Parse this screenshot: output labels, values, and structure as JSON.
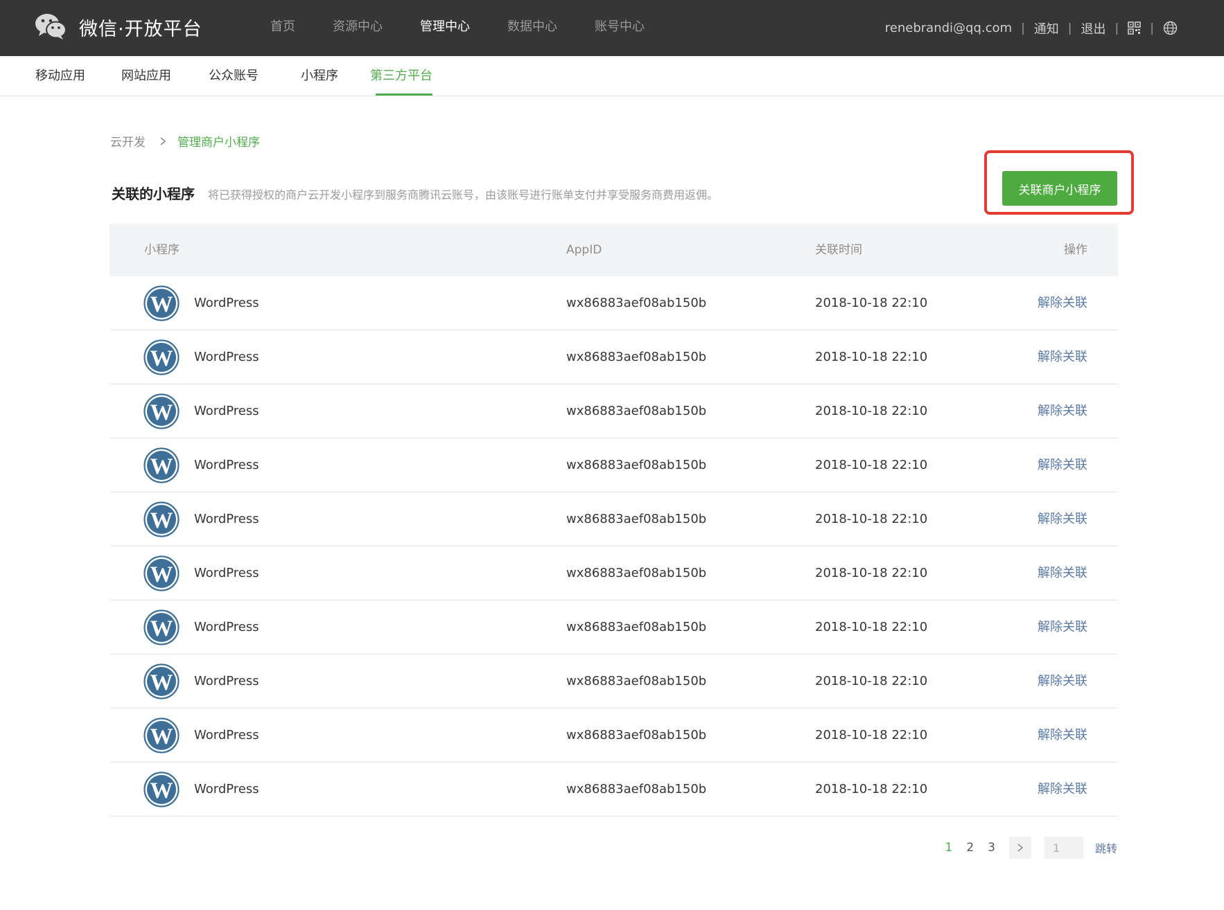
{
  "header": {
    "brand": "微信·开放平台",
    "nav": [
      {
        "label": "首页",
        "active": false
      },
      {
        "label": "资源中心",
        "active": false
      },
      {
        "label": "管理中心",
        "active": true
      },
      {
        "label": "数据中心",
        "active": false
      },
      {
        "label": "账号中心",
        "active": false
      }
    ],
    "user_email": "renebrandi@qq.com",
    "notify_label": "通知",
    "logout_label": "退出",
    "separator": "|"
  },
  "subnav": {
    "items": [
      {
        "label": "移动应用",
        "active": false
      },
      {
        "label": "网站应用",
        "active": false
      },
      {
        "label": "公众账号",
        "active": false
      },
      {
        "label": "小程序",
        "active": false
      },
      {
        "label": "第三方平台",
        "active": true
      }
    ]
  },
  "breadcrumb": {
    "root": "云开发",
    "current": "管理商户小程序"
  },
  "section": {
    "title": "关联的小程序",
    "description": "将已获得授权的商户云开发小程序到服务商腾讯云账号，由该账号进行账单支付并享受服务商费用返佣。",
    "primary_button": "关联商户小程序"
  },
  "table": {
    "columns": [
      "小程序",
      "AppID",
      "关联时间",
      "操作"
    ],
    "rows": [
      {
        "name": "WordPress",
        "appid": "wx86883aef08ab150b",
        "time": "2018-10-18 22:10",
        "action": "解除关联"
      },
      {
        "name": "WordPress",
        "appid": "wx86883aef08ab150b",
        "time": "2018-10-18 22:10",
        "action": "解除关联"
      },
      {
        "name": "WordPress",
        "appid": "wx86883aef08ab150b",
        "time": "2018-10-18 22:10",
        "action": "解除关联"
      },
      {
        "name": "WordPress",
        "appid": "wx86883aef08ab150b",
        "time": "2018-10-18 22:10",
        "action": "解除关联"
      },
      {
        "name": "WordPress",
        "appid": "wx86883aef08ab150b",
        "time": "2018-10-18 22:10",
        "action": "解除关联"
      },
      {
        "name": "WordPress",
        "appid": "wx86883aef08ab150b",
        "time": "2018-10-18 22:10",
        "action": "解除关联"
      },
      {
        "name": "WordPress",
        "appid": "wx86883aef08ab150b",
        "time": "2018-10-18 22:10",
        "action": "解除关联"
      },
      {
        "name": "WordPress",
        "appid": "wx86883aef08ab150b",
        "time": "2018-10-18 22:10",
        "action": "解除关联"
      },
      {
        "name": "WordPress",
        "appid": "wx86883aef08ab150b",
        "time": "2018-10-18 22:10",
        "action": "解除关联"
      },
      {
        "name": "WordPress",
        "appid": "wx86883aef08ab150b",
        "time": "2018-10-18 22:10",
        "action": "解除关联"
      }
    ]
  },
  "pagination": {
    "pages": [
      "1",
      "2",
      "3"
    ],
    "current": "1",
    "input_value": "1",
    "jump_label": "跳转"
  },
  "colors": {
    "accent_green": "#4eb04a",
    "button_green": "#4eab3f",
    "link_blue": "#5a78a8",
    "header_bg": "#363636",
    "highlight_red": "#e53a2f"
  },
  "icons": {
    "logo": "wechat-logo-icon",
    "row_avatar": "wordpress-icon",
    "qr": "qr-code-icon",
    "language": "globe-icon",
    "breadcrumb_sep": "chevron-right-icon",
    "next_page": "chevron-right-icon"
  }
}
